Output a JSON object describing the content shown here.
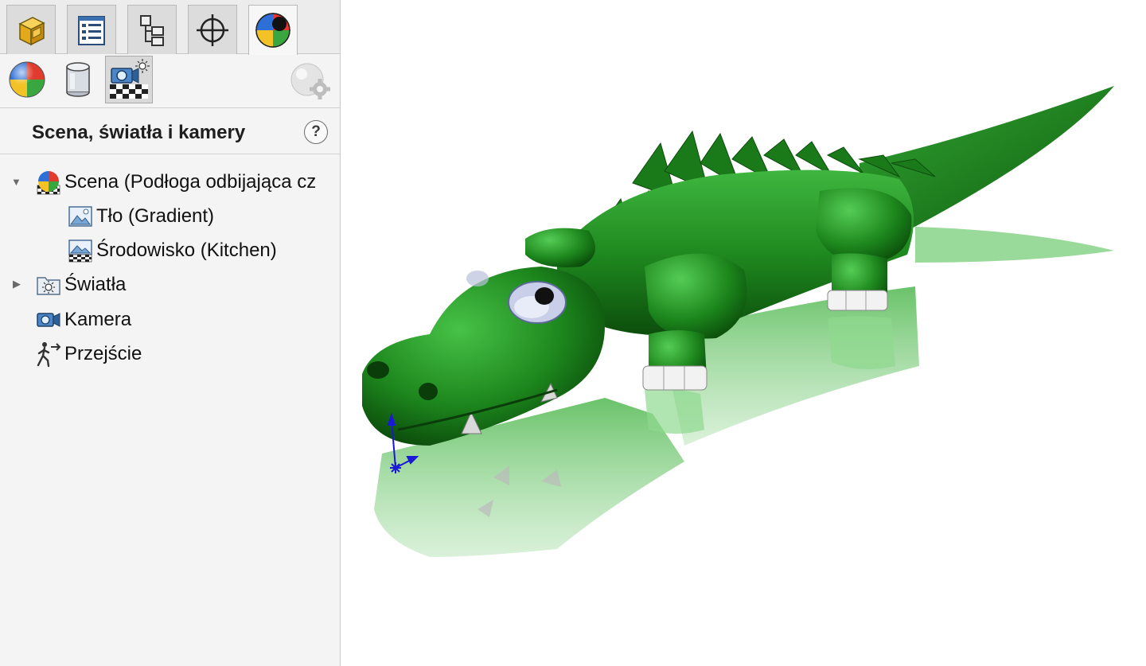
{
  "tabs": [
    {
      "name": "part-tab",
      "icon": "part-icon"
    },
    {
      "name": "property-tab",
      "icon": "property-manager-icon"
    },
    {
      "name": "configuration-tab",
      "icon": "configuration-manager-icon"
    },
    {
      "name": "dimxpert-tab",
      "icon": "crosshair-icon"
    },
    {
      "name": "display-tab",
      "icon": "appearance-ball-icon",
      "active": true
    }
  ],
  "subtabs": [
    {
      "name": "appearances",
      "icon": "appearance-ball-icon"
    },
    {
      "name": "decals",
      "icon": "decal-cylinder-icon"
    },
    {
      "name": "scene-lights-cameras",
      "icon": "scene-camera-icon",
      "active": true
    }
  ],
  "panel": {
    "title": "Scena, światła i kamery",
    "help_icon": "help-icon",
    "help_text": "?"
  },
  "tree": {
    "scene": {
      "label": "Scena (Podłoga odbijająca cz",
      "expanded": true
    },
    "background": {
      "label": "Tło (Gradient)"
    },
    "environment": {
      "label": "Środowisko (Kitchen)"
    },
    "lights": {
      "label": "Światła",
      "expanded": false
    },
    "camera": {
      "label": "Kamera"
    },
    "walkthrough": {
      "label": "Przejście"
    }
  },
  "viewport": {
    "model": "crocodile-model",
    "model_color": "#1f8a1f",
    "reflection_color": "#6cc46c",
    "triad_color": "#1a1ad6"
  }
}
